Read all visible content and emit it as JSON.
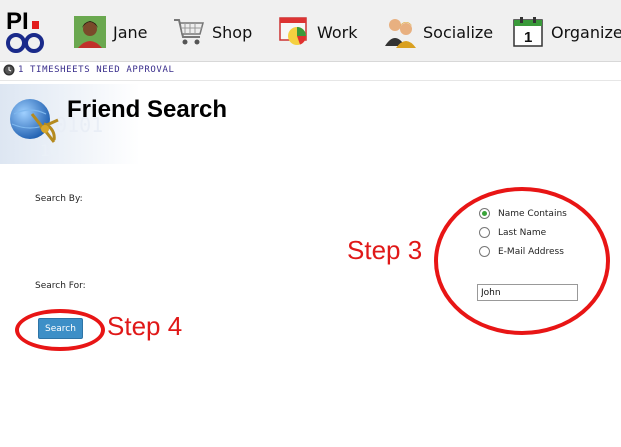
{
  "nav": {
    "logo_text": "PI.",
    "items": [
      {
        "label": "Jane",
        "icon": "user-avatar-icon"
      },
      {
        "label": "Shop",
        "icon": "shopping-cart-icon"
      },
      {
        "label": "Work",
        "icon": "chart-icon"
      },
      {
        "label": "Socialize",
        "icon": "people-icon"
      },
      {
        "label": "Organize",
        "icon": "calendar-icon"
      }
    ]
  },
  "notice": {
    "text": "1 TIMESHEETS NEED APPROVAL",
    "icon": "clock-icon"
  },
  "page": {
    "title": "Friend Search",
    "header_icon": "globe-sextant-icon"
  },
  "form": {
    "search_by_label": "Search By:",
    "search_for_label": "Search For:",
    "options": [
      {
        "label": "Name Contains",
        "checked": true
      },
      {
        "label": "Last Name",
        "checked": false
      },
      {
        "label": "E-Mail Address",
        "checked": false
      }
    ],
    "search_value": "John",
    "search_button": "Search"
  },
  "annotations": {
    "step3": "Step 3",
    "step4": "Step 4",
    "color": "#e01818"
  },
  "colors": {
    "accent": "#3d8fc7",
    "notice_text": "#3a2e8c",
    "radio_selected": "#3aa33a"
  }
}
